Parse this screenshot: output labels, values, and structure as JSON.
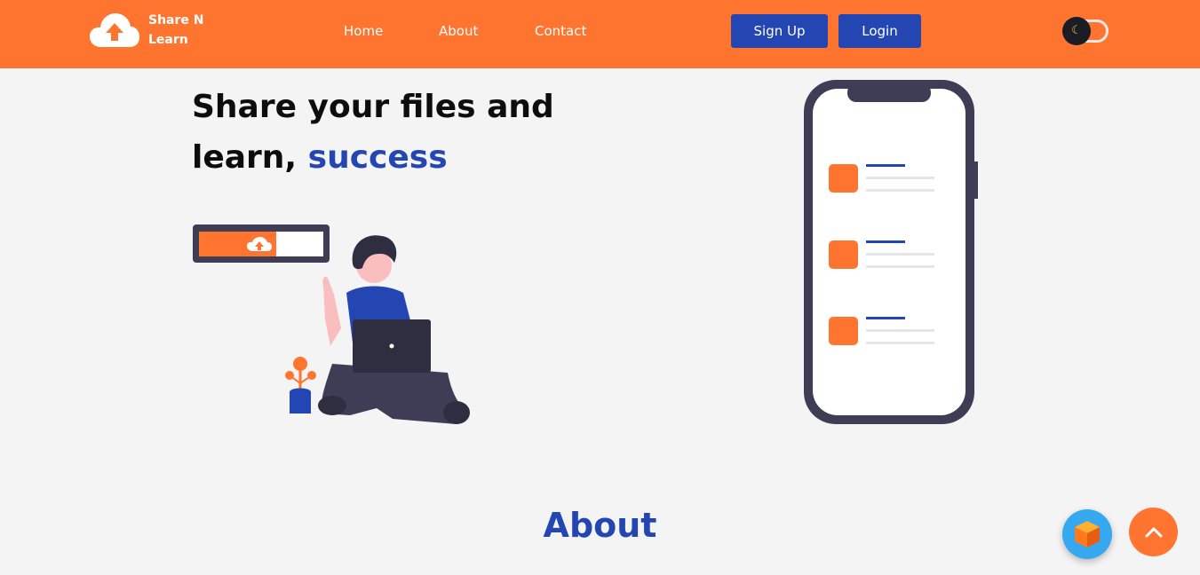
{
  "header": {
    "brand": "Share N Learn",
    "nav": [
      "Home",
      "About",
      "Contact"
    ],
    "signup_label": "Sign Up",
    "login_label": "Login",
    "theme_icon": "moon-icon"
  },
  "hero": {
    "title_main": "Share your files and learn, ",
    "title_accent": "success"
  },
  "about": {
    "title": "About"
  },
  "colors": {
    "accent": "#ff7530",
    "brand_blue": "#2446b3",
    "background": "#f4f4f4"
  },
  "fabs": {
    "cube_icon": "cube-icon",
    "top_icon": "chevron-up-icon"
  }
}
